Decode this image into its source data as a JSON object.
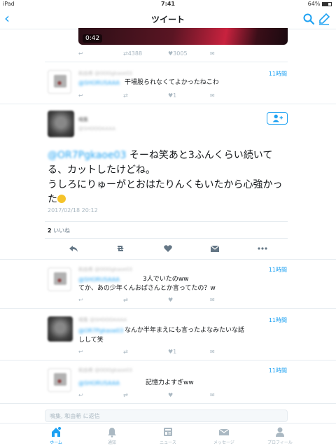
{
  "status_bar": {
    "device": "iPad",
    "time": "7:41",
    "battery": "64%"
  },
  "nav": {
    "title": "ツイート"
  },
  "video": {
    "duration": "0:42"
  },
  "top_tweet_actions": {
    "retweets": "4388",
    "likes": "3005"
  },
  "replies_before": [
    {
      "name": "和由希 @OOOgkaoe03",
      "mention": "@SHORUSAAA",
      "text": "干場股られなくてよかったねこわ",
      "time": "11時間",
      "likes": "1"
    }
  ],
  "main_tweet": {
    "name": "鳴集",
    "handle": "@SHOOOAAAA",
    "mention": "@OR7Pgkaoe03",
    "text_1": "そーね笑あと3ふんくらい続いてる、カットしたけどね。",
    "text_2": "うしろにりゅーがとおはたりんくもいたから心強かった",
    "datetime": "2017/02/18 20:12",
    "likes_count": "2",
    "likes_label": "いいね"
  },
  "replies_after": [
    {
      "name": "和由希 @OOOgkaoe03",
      "mention": "@SHORUSAAA",
      "text_1": "3人でいたのww",
      "text_2": "てか、あの少年くんおばさんとか言ってたの？w",
      "time": "11時間",
      "likes": ""
    },
    {
      "name": "鳴集 @SHOOOAAAA",
      "mention": "@OR7Pgkaoe03",
      "text_1": "なんか半年まえにも言ったよなみたいな話",
      "text_2": "しして笑",
      "time": "11時間",
      "likes": "1"
    },
    {
      "name": "和由希 @OOOgkaoe03",
      "mention": "@SHORUSAAA",
      "text_1": "記憶力よすぎww",
      "time": "11時間",
      "likes": ""
    }
  ],
  "reply_bar": {
    "placeholder": "鳴集, 和由希 に返信"
  },
  "tabs": [
    {
      "label": "ホーム",
      "icon": "home-icon"
    },
    {
      "label": "通知",
      "icon": "bell-icon"
    },
    {
      "label": "ニュース",
      "icon": "news-icon"
    },
    {
      "label": "メッセージ",
      "icon": "mail-icon"
    },
    {
      "label": "プロフィール",
      "icon": "profile-icon"
    }
  ],
  "colors": {
    "accent": "#1da1f2",
    "muted": "#aab8c2",
    "text": "#14171a",
    "divider": "#e6ecf0"
  }
}
